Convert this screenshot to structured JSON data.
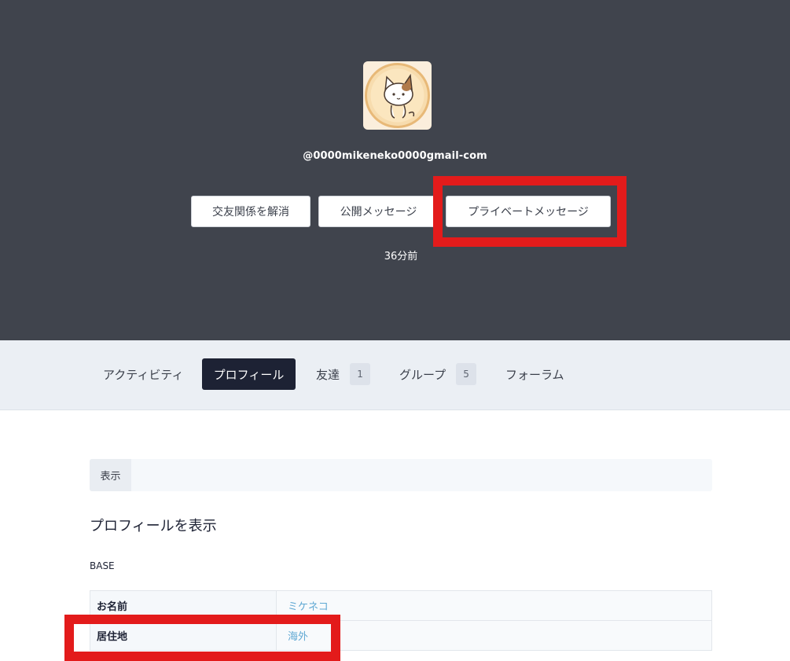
{
  "profile": {
    "username": "@0000mikeneko0000gmail-com",
    "last_active": "36分前"
  },
  "actions": {
    "unfriend_label": "交友関係を解消",
    "public_message_label": "公開メッセージ",
    "private_message_label": "プライベートメッセージ"
  },
  "tabs": {
    "activity": "アクティビティ",
    "profile": "プロフィール",
    "friends": "友達",
    "friends_count": "1",
    "groups": "グループ",
    "groups_count": "5",
    "forums": "フォーラム"
  },
  "subnav": {
    "view_label": "表示"
  },
  "content": {
    "heading": "プロフィールを表示",
    "group_label": "BASE",
    "fields": [
      {
        "label": "お名前",
        "value": "ミケネコ"
      },
      {
        "label": "居住地",
        "value": "海外"
      }
    ]
  },
  "colors": {
    "hero_bg": "#40444d",
    "highlight": "#e31b1b",
    "active_tab": "#1d2234",
    "link": "#5fa8d3"
  }
}
